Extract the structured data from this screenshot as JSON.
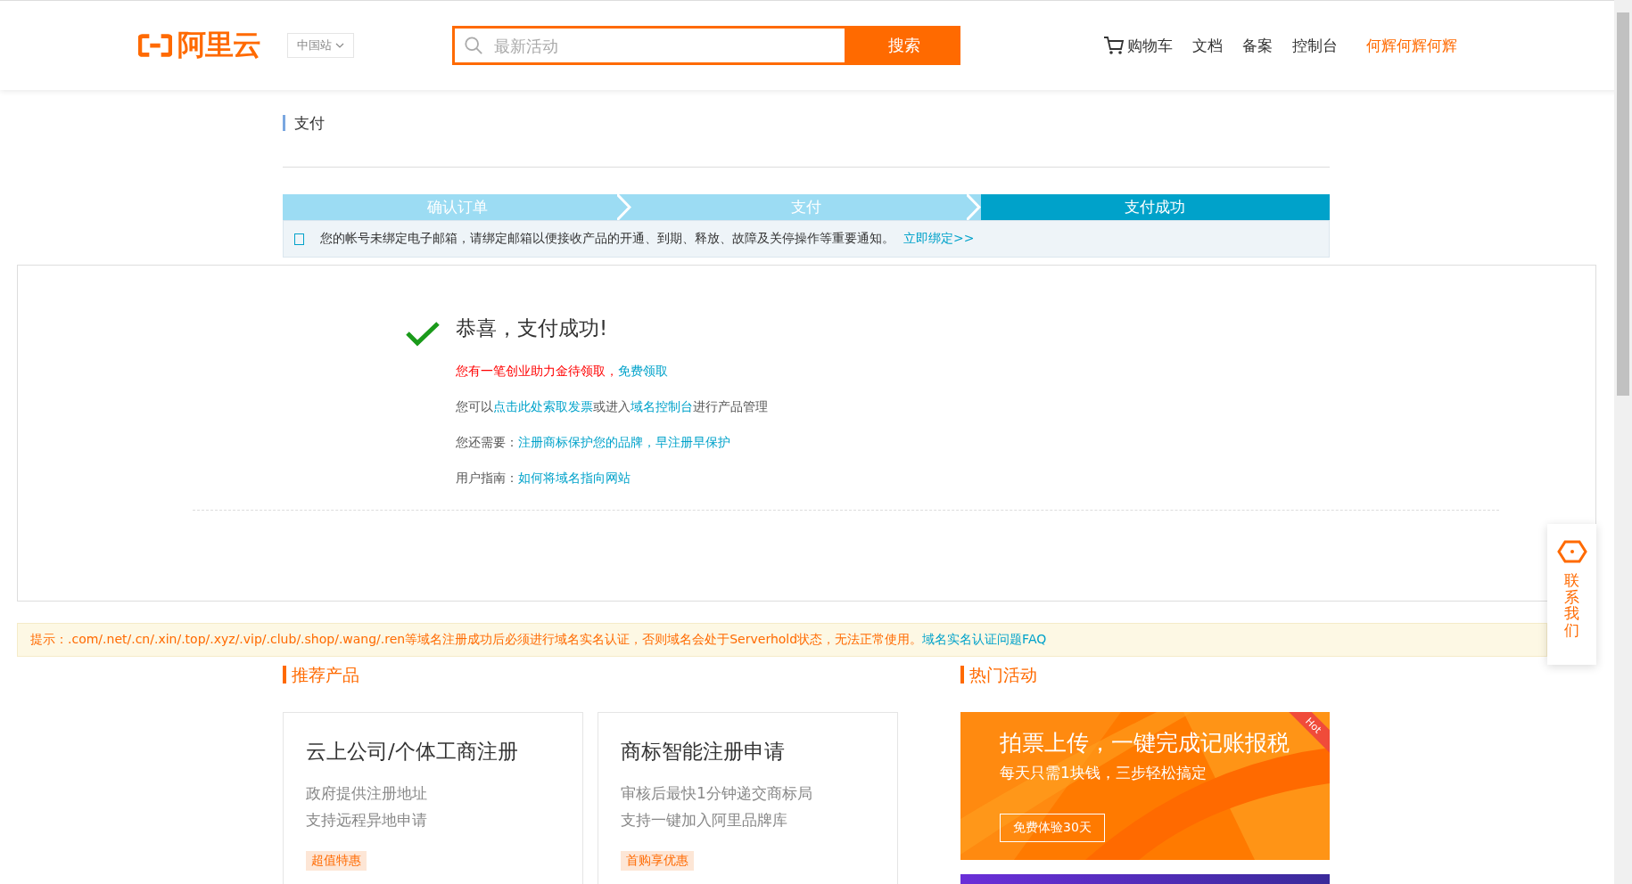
{
  "header": {
    "logo": "阿里云",
    "region": "中国站",
    "search": {
      "placeholder": "最新活动",
      "button": "搜索"
    },
    "nav": [
      {
        "label": "购物车",
        "kind": "cart"
      },
      {
        "label": "文档",
        "kind": "link"
      },
      {
        "label": "备案",
        "kind": "link"
      },
      {
        "label": "控制台",
        "kind": "link"
      },
      {
        "label": "何辉何辉何辉",
        "kind": "user"
      }
    ]
  },
  "page_title": "支付",
  "steps": [
    {
      "label": "确认订单",
      "selected": false
    },
    {
      "label": "支付",
      "selected": false
    },
    {
      "label": "支付成功",
      "selected": true
    }
  ],
  "notice": {
    "checked": false,
    "text": "您的帐号未绑定电子邮箱，请绑定邮箱以便接收产品的开通、到期、释放、故障及关停操作等重要通知。",
    "link": "立即绑定>>"
  },
  "success": {
    "title": "恭喜，支付成功!",
    "lines": [
      [
        {
          "text": "您有一笔创业助力金待领取，",
          "kind": "alert"
        },
        {
          "text": "免费领取",
          "kind": "link"
        }
      ],
      [
        {
          "text": "您可以",
          "kind": "plain"
        },
        {
          "text": "点击此处索取发票",
          "kind": "link"
        },
        {
          "text": "或进入",
          "kind": "plain"
        },
        {
          "text": "域名控制台",
          "kind": "link"
        },
        {
          "text": "进行产品管理",
          "kind": "plain"
        }
      ],
      [
        {
          "text": "您还需要：",
          "kind": "plain"
        },
        {
          "text": "注册商标保护您的品牌，早注册早保护",
          "kind": "link"
        }
      ],
      [
        {
          "text": "用户指南：",
          "kind": "plain"
        },
        {
          "text": "如何将域名指向网站",
          "kind": "link"
        }
      ]
    ]
  },
  "tip": {
    "text": "提示：.com/.net/.cn/.xin/.top/.xyz/.vip/.club/.shop/.wang/.ren等域名注册成功后必须进行域名实名认证，否则域名会处于Serverhold状态，无法正常使用。",
    "link": "域名实名认证问题FAQ"
  },
  "recommended": {
    "title": "推荐产品",
    "cards": [
      {
        "title": "云上公司/个体工商注册",
        "lines": [
          "政府提供注册地址",
          "支持远程异地申请"
        ],
        "tag": "超值特惠"
      },
      {
        "title": "商标智能注册申请",
        "lines": [
          "审核后最快1分钟递交商标局",
          "支持一键加入阿里品牌库"
        ],
        "tag": "首购享优惠"
      }
    ]
  },
  "hot": {
    "title": "热门活动",
    "promo": {
      "badge": "Hot",
      "title": "拍票上传，一键完成记账报税",
      "subtitle": "每天只需1块钱，三步轻松搞定",
      "button": "免费体验30天"
    }
  },
  "contact": "联系我们"
}
